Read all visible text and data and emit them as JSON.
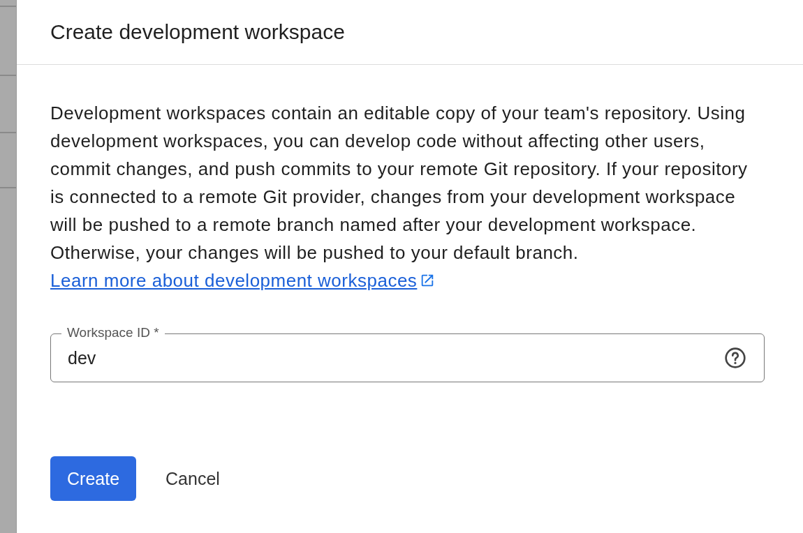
{
  "dialog": {
    "title": "Create development workspace",
    "description": "Development workspaces contain an editable copy of your team's repository. Using development workspaces, you can develop code without affecting other users, commit changes, and push commits to your remote Git repository. If your repository is connected to a remote Git provider, changes from your development workspace will be pushed to a remote branch named after your development workspace. Otherwise, your changes will be pushed to your default branch.",
    "link": "Learn more about development workspaces",
    "field": {
      "label": "Workspace ID *",
      "value": "dev"
    },
    "buttons": [
      {
        "label": "Create",
        "kind": "primary"
      },
      {
        "label": "Cancel",
        "kind": "text"
      }
    ]
  }
}
